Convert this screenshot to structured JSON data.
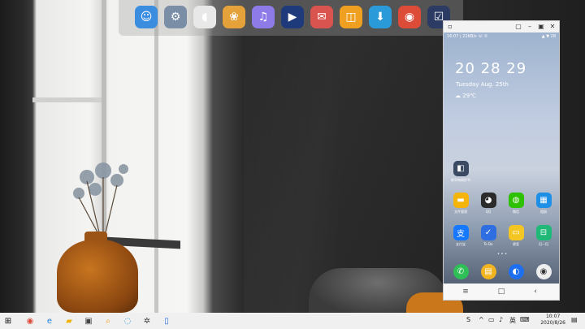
{
  "dock": {
    "items": [
      {
        "name": "finder",
        "icon": "finder-icon",
        "color": "#3b8de0",
        "glyph": "☺"
      },
      {
        "name": "settings",
        "icon": "gear-icon",
        "color": "#7a8ea6",
        "glyph": "⚙"
      },
      {
        "name": "cup",
        "icon": "cup-icon",
        "color": "#e8e8e8",
        "glyph": "◖"
      },
      {
        "name": "photos",
        "icon": "photos-icon",
        "color": "#e5a13a",
        "glyph": "❀"
      },
      {
        "name": "music",
        "icon": "music-icon",
        "color": "#8e7be8",
        "glyph": "♫"
      },
      {
        "name": "player",
        "icon": "play-icon",
        "color": "#1f3a7a",
        "glyph": "▶"
      },
      {
        "name": "mail",
        "icon": "mail-icon",
        "color": "#d9534f",
        "glyph": "✉"
      },
      {
        "name": "books",
        "icon": "books-icon",
        "color": "#f0a020",
        "glyph": "◫"
      },
      {
        "name": "download",
        "icon": "download-icon",
        "color": "#2a9bd8",
        "glyph": "⬇"
      },
      {
        "name": "chrome",
        "icon": "chrome-icon",
        "color": "#dd4b39",
        "glyph": "◉"
      },
      {
        "name": "tasks",
        "icon": "checkbox-icon",
        "color": "#2b3b63",
        "glyph": "☑"
      }
    ]
  },
  "phone": {
    "status_left": "16:07 | 22KB/s ☏ ✆",
    "status_right": "▲ ▼ 28",
    "clock": "20 28 29",
    "date": "Tuesday  Aug. 25th",
    "weather": "29℃",
    "folder_label": "新华每周好书",
    "rows": [
      [
        {
          "label": "文件管理",
          "icon": "folder-icon",
          "color": "#f5b40a",
          "glyph": "▬"
        },
        {
          "label": "QQ",
          "icon": "qq-icon",
          "color": "#2b2b2b",
          "glyph": "◕"
        },
        {
          "label": "微信",
          "icon": "wechat-icon",
          "color": "#2dc100",
          "glyph": "◍"
        },
        {
          "label": "相册",
          "icon": "gallery-icon",
          "color": "#1e8fe6",
          "glyph": "▦"
        }
      ],
      [
        {
          "label": "支付宝",
          "icon": "alipay-icon",
          "color": "#1677ff",
          "glyph": "支"
        },
        {
          "label": "To Do",
          "icon": "todo-icon",
          "color": "#2f6ee0",
          "glyph": "✓"
        },
        {
          "label": "便签",
          "icon": "notes-icon",
          "color": "#f3c623",
          "glyph": "▭"
        },
        {
          "label": "扫一扫",
          "icon": "scan-icon",
          "color": "#20b877",
          "glyph": "⊟"
        }
      ]
    ],
    "dock_apps": [
      {
        "icon": "phone-icon",
        "color": "#2fbf57",
        "glyph": "✆"
      },
      {
        "icon": "messages-icon",
        "color": "#f3b422",
        "glyph": "▤"
      },
      {
        "icon": "browser-icon",
        "color": "#1e6ff0",
        "glyph": "◐"
      },
      {
        "icon": "camera-icon",
        "color": "#eeeeee",
        "glyph": "◉"
      }
    ]
  },
  "taskbar": {
    "time": "10:07",
    "date": "2020/8/26",
    "apps": [
      {
        "icon": "chrome-icon",
        "color": "#dd4b39",
        "glyph": "◉"
      },
      {
        "icon": "edge-icon",
        "color": "#1e7fd8",
        "glyph": "e"
      },
      {
        "icon": "file-explorer-icon",
        "color": "#f0b400",
        "glyph": "▰"
      },
      {
        "icon": "store-icon",
        "color": "#444",
        "glyph": "▣"
      },
      {
        "icon": "search-app-icon",
        "color": "#f39c12",
        "glyph": "⌕"
      },
      {
        "icon": "browser-blue-icon",
        "color": "#2a9bd8",
        "glyph": "◌"
      },
      {
        "icon": "game-icon",
        "color": "#444",
        "glyph": "✲"
      },
      {
        "icon": "phone-mirror-icon",
        "color": "#2a6fdb",
        "glyph": "▯"
      }
    ]
  }
}
